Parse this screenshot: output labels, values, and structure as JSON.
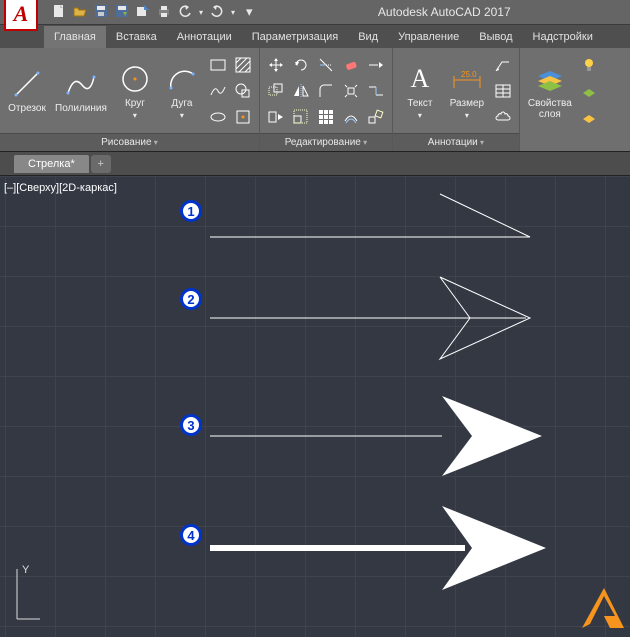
{
  "app": {
    "title": "Autodesk AutoCAD 2017",
    "logo_letter": "A"
  },
  "qat": {
    "new": "new-icon",
    "open": "open-icon",
    "save": "save-icon",
    "saveas": "saveas-icon",
    "export": "export-icon",
    "print": "print-icon",
    "undo": "undo-icon",
    "redo": "redo-icon",
    "more": "▾"
  },
  "tabs": {
    "home": "Главная",
    "insert": "Вставка",
    "annotate": "Аннотации",
    "parametric": "Параметризация",
    "view": "Вид",
    "manage": "Управление",
    "output": "Вывод",
    "addins": "Надстройки"
  },
  "ribbon": {
    "draw": {
      "title": "Рисование",
      "line": "Отрезок",
      "polyline": "Полилиния",
      "circle": "Круг",
      "arc": "Дуга"
    },
    "modify": {
      "title": "Редактирование"
    },
    "annotation": {
      "title": "Аннотации",
      "text": "Текст",
      "dimension": "Размер"
    },
    "layers": {
      "title": "Свойства\nслоя"
    }
  },
  "doctabs": {
    "tab1": "Стрелка*",
    "add": "+"
  },
  "canvas": {
    "view_label": "[–][Сверху][2D-каркас]",
    "marker1": "1",
    "marker2": "2",
    "marker3": "3",
    "marker4": "4",
    "ucs_y": "Y"
  }
}
